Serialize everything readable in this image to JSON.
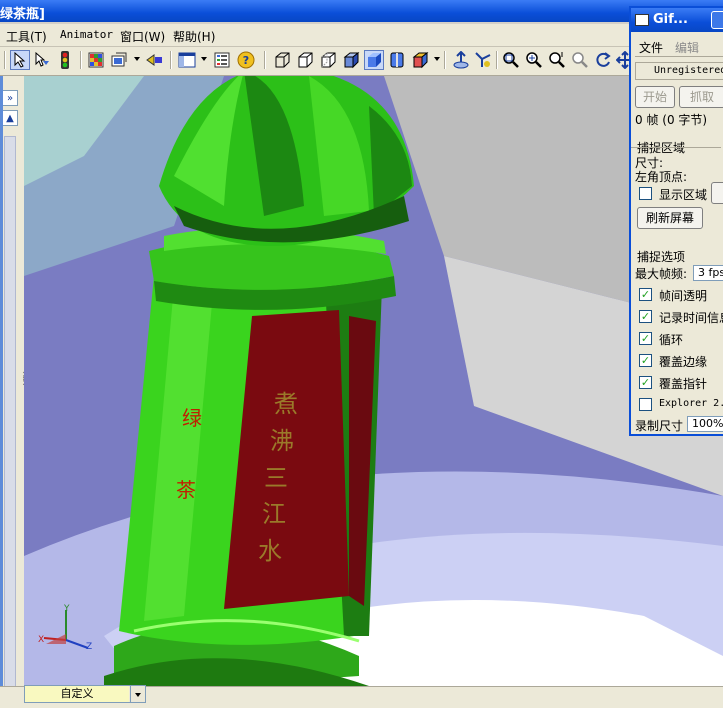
{
  "window": {
    "title": "绿茶瓶]"
  },
  "menu": [
    {
      "label": "工具(T)"
    },
    {
      "label": "Animator"
    },
    {
      "label": "窗口(W)"
    },
    {
      "label": "帮助(H)"
    }
  ],
  "toolbar": {
    "icons": [
      "select-icon",
      "select-filter-icon",
      "traffic-light-icon",
      "grid-icon",
      "view-orientation-icon",
      "rebuild-icon",
      "layout-icon",
      "properties-icon",
      "help-icon",
      "box-wire-icon",
      "box-hidden-icon",
      "box-gray-icon",
      "box-shaded-icon",
      "box-shaded-edges-icon",
      "section-view-icon",
      "appearance-icon",
      "normal-to-icon",
      "perspective-icon",
      "zoom-fit-icon",
      "zoom-area-icon",
      "zoom-inout-icon",
      "zoom-selection-icon",
      "rotate-icon",
      "pan-icon"
    ]
  },
  "viewport": {
    "bottle_labels": {
      "left_column": [
        "绿",
        "茶"
      ],
      "red_panel": [
        "煮",
        "沸",
        "三",
        "江",
        "水"
      ]
    },
    "triad": {
      "x": "X",
      "y": "Y",
      "z": "Z"
    }
  },
  "bottom": {
    "view_combo": "自定义"
  },
  "gif_capture": {
    "title": "Gif...",
    "menu": {
      "file": "文件",
      "edit": "编辑"
    },
    "registration": "Unregistered",
    "start_button": "开始",
    "capture_button": "抓取",
    "frames_status": "0 帧 (0 字节)",
    "capture_region_group": "捕捉区域",
    "size_label": "尺寸:",
    "top_left_label": "左角顶点:",
    "show_region_label": "显示区域",
    "show_region_checked": false,
    "refresh_button": "刷新屏幕",
    "options_group": "捕捉选项",
    "max_fps_label": "最大帧频:",
    "max_fps_value": "3 fps",
    "options": [
      {
        "label": "帧间透明",
        "checked": true
      },
      {
        "label": "记录时间信息",
        "checked": true
      },
      {
        "label": "循环",
        "checked": true
      },
      {
        "label": "覆盖边缘",
        "checked": true
      },
      {
        "label": "覆盖指针",
        "checked": true
      },
      {
        "label": "Explorer 2.",
        "checked": false
      }
    ],
    "record_size_label": "录制尺寸",
    "record_size_value": "100%"
  }
}
